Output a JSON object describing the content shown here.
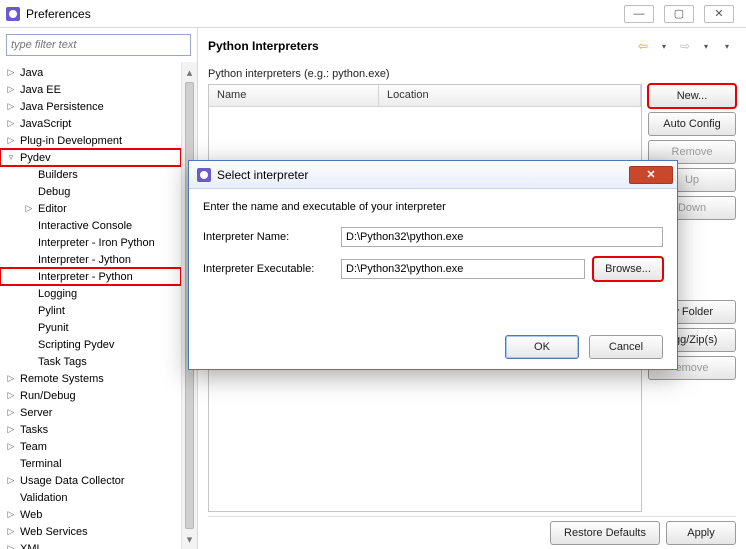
{
  "preferences": {
    "window_title": "Preferences",
    "minimize_glyph": "—",
    "maximize_glyph": "▢",
    "close_glyph": "✕",
    "filter_placeholder": "type filter text",
    "tree_up_glyph": "▴",
    "tree_down_glyph": "▾",
    "tree": [
      {
        "label": "Java",
        "depth": 1,
        "expander": "▷"
      },
      {
        "label": "Java EE",
        "depth": 1,
        "expander": "▷"
      },
      {
        "label": "Java Persistence",
        "depth": 1,
        "expander": "▷"
      },
      {
        "label": "JavaScript",
        "depth": 1,
        "expander": "▷"
      },
      {
        "label": "Plug-in Development",
        "depth": 1,
        "expander": "▷"
      },
      {
        "label": "Pydev",
        "depth": 1,
        "expander": "▿",
        "highlighted": true
      },
      {
        "label": "Builders",
        "depth": 2,
        "expander": ""
      },
      {
        "label": "Debug",
        "depth": 2,
        "expander": ""
      },
      {
        "label": "Editor",
        "depth": 2,
        "expander": "▷"
      },
      {
        "label": "Interactive Console",
        "depth": 2,
        "expander": ""
      },
      {
        "label": "Interpreter - Iron Python",
        "depth": 2,
        "expander": ""
      },
      {
        "label": "Interpreter - Jython",
        "depth": 2,
        "expander": ""
      },
      {
        "label": "Interpreter - Python",
        "depth": 2,
        "expander": "",
        "highlighted": true
      },
      {
        "label": "Logging",
        "depth": 2,
        "expander": ""
      },
      {
        "label": "Pylint",
        "depth": 2,
        "expander": ""
      },
      {
        "label": "Pyunit",
        "depth": 2,
        "expander": ""
      },
      {
        "label": "Scripting Pydev",
        "depth": 2,
        "expander": ""
      },
      {
        "label": "Task Tags",
        "depth": 2,
        "expander": ""
      },
      {
        "label": "Remote Systems",
        "depth": 1,
        "expander": "▷"
      },
      {
        "label": "Run/Debug",
        "depth": 1,
        "expander": "▷"
      },
      {
        "label": "Server",
        "depth": 1,
        "expander": "▷"
      },
      {
        "label": "Tasks",
        "depth": 1,
        "expander": "▷"
      },
      {
        "label": "Team",
        "depth": 1,
        "expander": "▷"
      },
      {
        "label": "Terminal",
        "depth": 1,
        "expander": ""
      },
      {
        "label": "Usage Data Collector",
        "depth": 1,
        "expander": "▷"
      },
      {
        "label": "Validation",
        "depth": 1,
        "expander": ""
      },
      {
        "label": "Web",
        "depth": 1,
        "expander": "▷"
      },
      {
        "label": "Web Services",
        "depth": 1,
        "expander": "▷"
      },
      {
        "label": "XML",
        "depth": 1,
        "expander": "▷"
      }
    ]
  },
  "main": {
    "heading": "Python Interpreters",
    "back_glyph": "⇦",
    "fwd_glyph": "⇨",
    "dropdown_glyph": "▾",
    "menu_glyph": "▾",
    "section_label": "Python interpreters (e.g.: python.exe)",
    "columns": {
      "name": "Name",
      "location": "Location"
    },
    "buttons": {
      "new": "New...",
      "auto_config": "Auto Config",
      "remove": "Remove",
      "up": "Up",
      "down": "Down"
    },
    "extra_buttons": {
      "new_folder": "w Folder",
      "egg_zip": "Egg/Zip(s)",
      "remove2": "emove"
    },
    "footer": {
      "restore": "Restore Defaults",
      "apply": "Apply"
    }
  },
  "modal": {
    "title": "Select interpreter",
    "close_glyph": "✕",
    "message": "Enter the name and executable of your interpreter",
    "name_label": "Interpreter Name:",
    "exec_label": "Interpreter Executable:",
    "name_value": "D:\\Python32\\python.exe",
    "exec_value": "D:\\Python32\\python.exe",
    "browse": "Browse...",
    "ok": "OK",
    "cancel": "Cancel"
  }
}
